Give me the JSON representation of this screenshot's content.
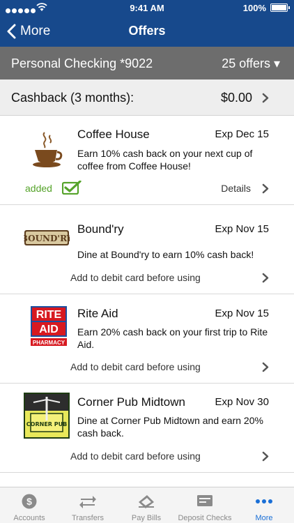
{
  "status_bar": {
    "time": "9:41 AM",
    "battery": "100%"
  },
  "nav": {
    "back_label": "More",
    "title": "Offers"
  },
  "account": {
    "name": "Personal Checking *9022",
    "offers_count": "25 offers ▾"
  },
  "cashback": {
    "label": "Cashback (3 months):",
    "amount": "$0.00"
  },
  "offers": [
    {
      "merchant": "Coffee House",
      "exp": "Exp Dec 15",
      "description": "Earn 10% cash back on your next cup of coffee from Coffee House!",
      "added_label": "added",
      "details_label": "Details",
      "logo": "coffee-cup-logo"
    },
    {
      "merchant": "Bound'ry",
      "exp": "Exp Nov 15",
      "description": "Dine at Bound'ry to earn 10% cash back!",
      "action": "Add to debit card before using",
      "logo": "boundry-logo",
      "logo_text": "BOUND'RY"
    },
    {
      "merchant": "Rite Aid",
      "exp": "Exp Nov 15",
      "description": "Earn 20% cash back on your first trip to Rite Aid.",
      "action": "Add to debit card before using",
      "logo": "rite-aid-logo",
      "logo_text": [
        "RITE",
        "AID",
        "PHARMACY"
      ]
    },
    {
      "merchant": "Corner Pub Midtown",
      "exp": "Exp Nov 30",
      "description": "Dine at Corner Pub Midtown and earn 20% cash back.",
      "action": "Add to debit card before using",
      "logo": "corner-pub-logo",
      "logo_text": "CORNER PUB"
    }
  ],
  "tabs": [
    {
      "label": "Accounts",
      "icon": "dollar-coin-icon"
    },
    {
      "label": "Transfers",
      "icon": "transfer-arrows-icon"
    },
    {
      "label": "Pay Bills",
      "icon": "pay-bills-icon"
    },
    {
      "label": "Deposit Checks",
      "icon": "deposit-check-icon"
    },
    {
      "label": "More",
      "icon": "more-dots-icon",
      "active": true
    }
  ],
  "colors": {
    "nav_blue": "#17498c",
    "account_gray": "#6d6d6d",
    "added_green": "#55a32a",
    "active_tab_blue": "#1a6fd6"
  }
}
